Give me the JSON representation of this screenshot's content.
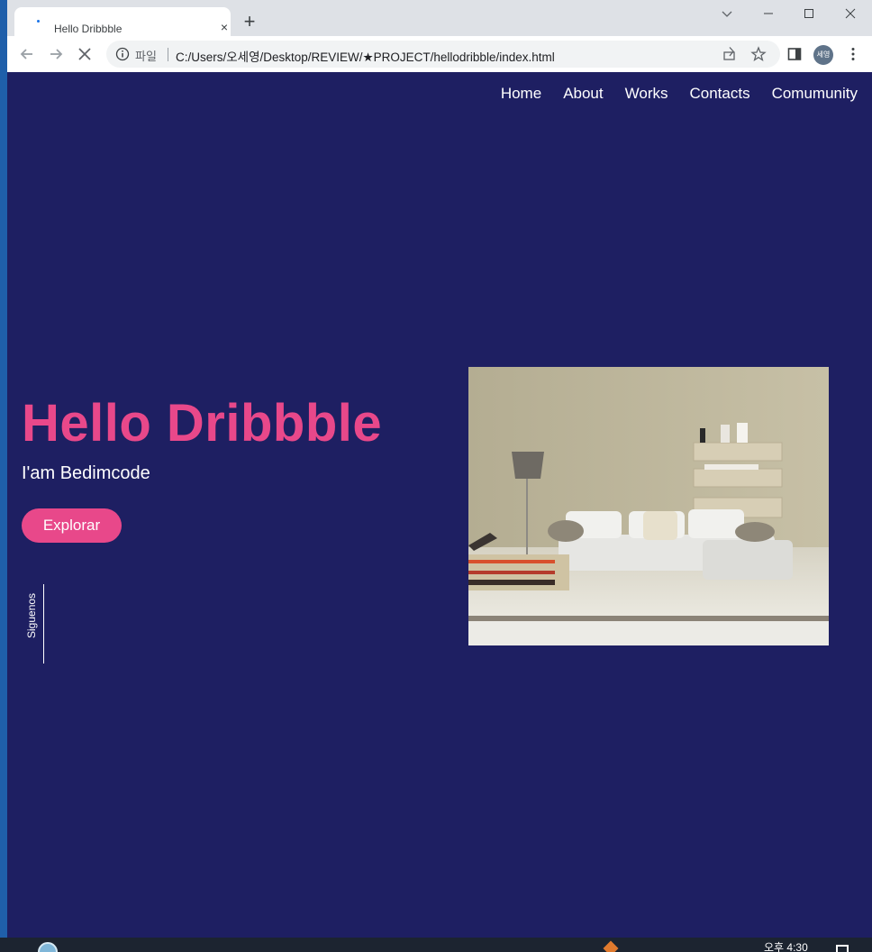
{
  "browser": {
    "tab_title": "Hello Dribbble",
    "tab_close": "×",
    "new_tab": "+",
    "address_label": "파일",
    "url": "C:/Users/오세영/Desktop/REVIEW/★PROJECT/hellodribble/index.html",
    "profile_initials": "세영"
  },
  "page": {
    "nav": [
      "Home",
      "About",
      "Works",
      "Contacts",
      "Comumunity"
    ],
    "hero_title": "Hello Dribbble",
    "hero_subtitle": "I'am Bedimcode",
    "cta_label": "Explorar",
    "follow_label": "Siguenos",
    "hero_image": "living-room-with-white-sofa"
  },
  "taskbar": {
    "clock": "오후 4:30"
  },
  "colors": {
    "page_bg": "#1e1f62",
    "accent": "#e8488a",
    "chrome_bg": "#dee1e6"
  }
}
